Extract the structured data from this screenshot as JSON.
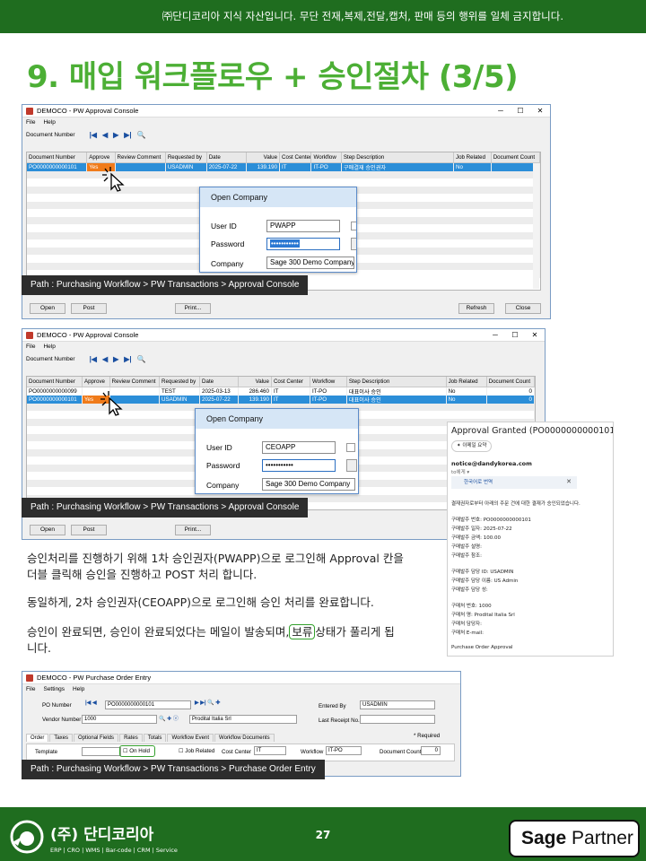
{
  "header": {
    "notice": "㈜단디코리아 지식 자산입니다. 무단 전재,복제,전달,캡처, 판매 등의 행위를 일체 금지합니다."
  },
  "title": "9. 매입 워크플로우 + 승인절차 (3/5)",
  "console1": {
    "window_title": "DEMOCO - PW Approval Console",
    "menu": [
      "File",
      "Help"
    ],
    "doc_label": "Document Number",
    "columns": [
      "Document Number",
      "Approve",
      "Review Comment",
      "Requested by",
      "Date",
      "Value",
      "Cost Center",
      "Workflow",
      "Step Description",
      "Job Related",
      "Document Count"
    ],
    "rows": [
      [
        "PO0000000000101",
        "Yes",
        "",
        "USADMIN",
        "2025-07-22",
        "139.190",
        "IT",
        "IT-PO",
        "구매결재 승인권자",
        "No",
        "0"
      ]
    ],
    "buttons": {
      "open": "Open",
      "post": "Post",
      "print": "Print...",
      "refresh": "Refresh",
      "close": "Close"
    },
    "dialog": {
      "title": "Open Company",
      "user_label": "User ID",
      "user_value": "PWAPP",
      "password_label": "Password",
      "password_value": "•••••••••••",
      "company_label": "Company",
      "company_value": "Sage 300 Demo Company"
    },
    "path": "Path : Purchasing Workflow > PW Transactions > Approval Console"
  },
  "console2": {
    "window_title": "DEMOCO - PW Approval Console",
    "menu": [
      "File",
      "Help"
    ],
    "doc_label": "Document Number",
    "columns": [
      "Document Number",
      "Approve",
      "Review Comment",
      "Requested by",
      "Date",
      "Value",
      "Cost Center",
      "Workflow",
      "Step Description",
      "Job Related",
      "Document Count"
    ],
    "rows": [
      [
        "PO0000000000099",
        "",
        "",
        "TEST",
        "2025-03-13",
        "286.460",
        "IT",
        "IT-PO",
        "대표이사 승인",
        "No",
        "0"
      ],
      [
        "PO0000000000101",
        "Yes",
        "",
        "USADMIN",
        "2025-07-22",
        "139.190",
        "IT",
        "IT-PO",
        "대표이사 승인",
        "No",
        "0"
      ]
    ],
    "buttons": {
      "open": "Open",
      "post": "Post",
      "print": "Print..."
    },
    "dialog": {
      "title": "Open Company",
      "user_label": "User ID",
      "user_value": "CEOAPP",
      "password_label": "Password",
      "password_value": "•••••••••••",
      "company_label": "Company",
      "company_value": "Sage 300 Demo Company"
    },
    "path": "Path : Purchasing Workflow > PW Transactions > Approval Console"
  },
  "email": {
    "subject": "Approval Granted (PO0000000000101)",
    "summary_badge": "✦ 이메일 요약",
    "from": "notice@dandykorea.com",
    "to": "to에게 ▾",
    "translate": "한국어로 번역",
    "lines": [
      "결재권자로부터 아래의 주문 건에 대한 결재가 승인되었습니다.",
      "구매발주 번호: PO0000000000101",
      "구매발주 일자: 2025-07-22",
      "구매발주 금액: 100.00",
      "구매발주 설명:",
      "구매발주 참조:",
      "구매발주 담당 ID: USADMIN",
      "구매발주 담당 이름: US Admin",
      "구매발주 담당 성:",
      "구매처 번호: 1000",
      "구매처 명: Prodital Italia Srl",
      "구매처 담당자:",
      "구매처 E-mail:",
      "Purchase Order Approval"
    ]
  },
  "body": {
    "p1_line1": "승인처리를 진행하기 위해 1차 승인권자(PWAPP)으로 로그인해 Approval 칸을",
    "p1_line2": "더블 클릭해 승인을 진행하고 POST 처리 합니다.",
    "p2": "동일하게, 2차 승인권자(CEOAPP)으로 로그인해 승인 처리를 완료합니다.",
    "p3_before": "승인이 완료되면, 승인이 완료되었다는 메일이 발송되며,",
    "p3_highlight": "보류",
    "p3_after": "상태가 풀리게 됩",
    "p3_line2": "니다."
  },
  "po_entry": {
    "window_title": "DEMOCO - PW Purchase Order Entry",
    "menu": [
      "File",
      "Settings",
      "Help"
    ],
    "po_number_label": "PO Number",
    "po_number": "PO0000000000101",
    "vendor_label": "Vendor Number",
    "vendor_number": "1000",
    "vendor_name": "Prodital Italia Srl",
    "entered_by_label": "Entered By",
    "entered_by": "USADMIN",
    "last_receipt_label": "Last Receipt No.",
    "tabs": [
      "Order",
      "Taxes",
      "Optional Fields",
      "Rates",
      "Totals",
      "Workflow Event",
      "Workflow Documents"
    ],
    "required": "* Required",
    "template_label": "Template",
    "on_hold": "On Hold",
    "job_related": "Job Related",
    "cost_center_label": "Cost Center",
    "cost_center": "IT",
    "workflow_label": "Workflow",
    "workflow": "IT-PO",
    "doc_count_label": "Document Count",
    "doc_count": "0",
    "path": "Path : Purchasing Workflow > PW Transactions > Purchase Order Entry"
  },
  "footer": {
    "logo_text": "(주) 단디코리아",
    "logo_sub": "ERP | CRO | WMS | Bar-code | CRM | Service",
    "page_number": "27",
    "partner_brand": "Sage",
    "partner_label": "Partner"
  }
}
